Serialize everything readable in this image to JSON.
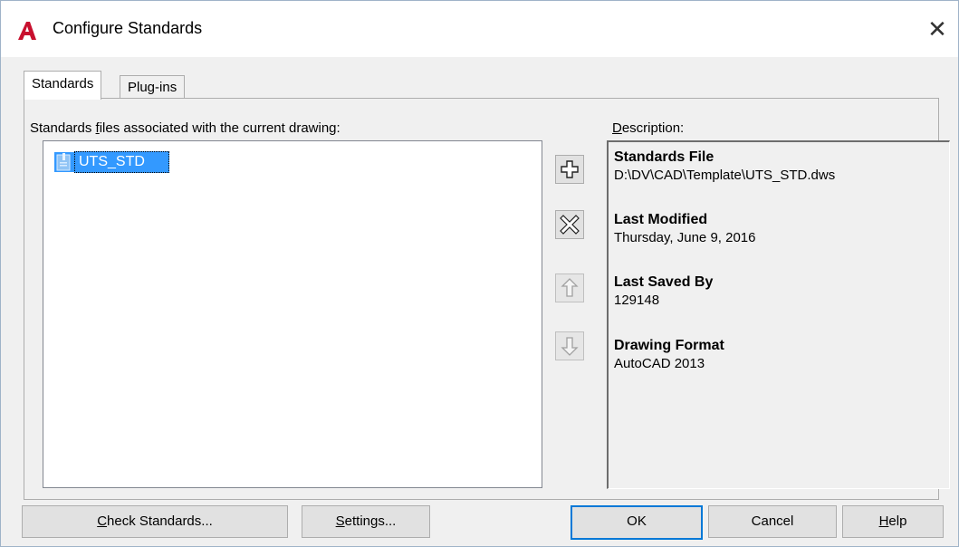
{
  "window": {
    "title": "Configure Standards",
    "close_glyph": "✕",
    "app_icon": "autocad-logo-icon",
    "accent_color": "#3399ff",
    "logo_color": "#c8102e"
  },
  "tabs": [
    {
      "label": "Standards",
      "active": true
    },
    {
      "label": "Plug-ins",
      "active": false
    }
  ],
  "standards_list": {
    "label_before": "Standards ",
    "label_accel": "f",
    "label_after": "iles associated with the current drawing:",
    "items": [
      {
        "label": "UTS_STD",
        "selected": true,
        "icon": "standards-file-icon"
      }
    ]
  },
  "side_buttons": [
    {
      "name": "add-standards-button",
      "icon": "plus-icon",
      "enabled": true
    },
    {
      "name": "remove-standards-button",
      "icon": "x-icon",
      "enabled": true
    },
    {
      "name": "move-up-button",
      "icon": "arrow-up-icon",
      "enabled": false
    },
    {
      "name": "move-down-button",
      "icon": "arrow-down-icon",
      "enabled": false
    }
  ],
  "description": {
    "label_accel": "D",
    "label_rest": "escription:",
    "sections": [
      {
        "heading": "Standards File",
        "value": "D:\\DV\\CAD\\Template\\UTS_STD.dws"
      },
      {
        "heading": "Last Modified",
        "value": "Thursday, June 9, 2016"
      },
      {
        "heading": "Last Saved By",
        "value": "129148"
      },
      {
        "heading": "Drawing Format",
        "value": "AutoCAD 2013"
      }
    ]
  },
  "buttons": {
    "check_accel": "C",
    "check_rest": "heck Standards...",
    "settings_accel": "S",
    "settings_rest": "ettings...",
    "ok": "OK",
    "cancel": "Cancel",
    "help_accel": "H",
    "help_rest": "elp"
  }
}
